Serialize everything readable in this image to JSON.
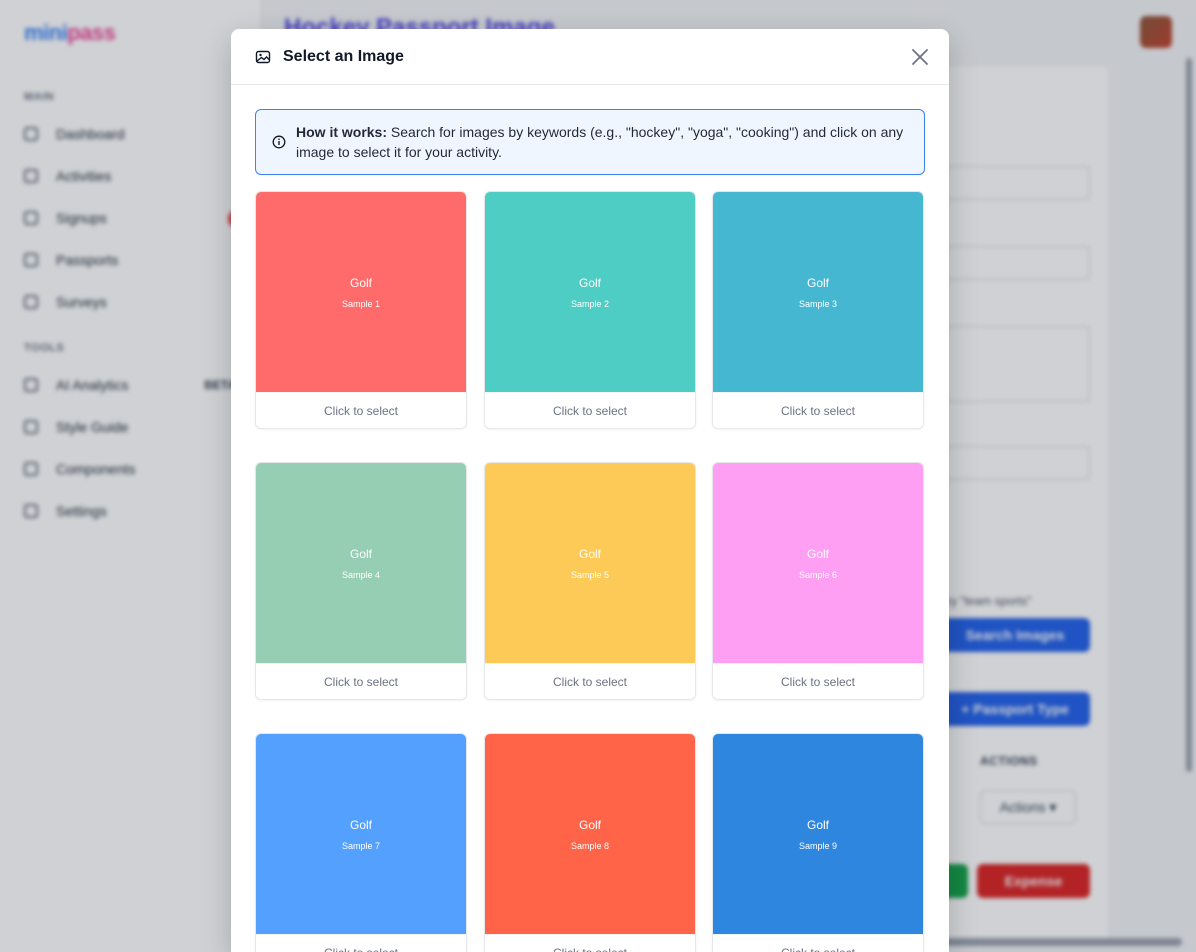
{
  "app": {
    "logo_part1": "mini",
    "logo_part2": "pass",
    "page_title": "Hockey Passport Image"
  },
  "sidebar": {
    "section_main": "MAIN",
    "section_tools": "TOOLS",
    "items": [
      {
        "label": "Dashboard",
        "icon": "home-icon"
      },
      {
        "label": "Activities",
        "icon": "activity-icon"
      },
      {
        "label": "Signups",
        "icon": "clipboard-icon"
      },
      {
        "label": "Passports",
        "icon": "passport-icon"
      },
      {
        "label": "Surveys",
        "icon": "survey-icon"
      }
    ],
    "tools": [
      {
        "label": "AI Analytics",
        "tag": "BETA",
        "icon": "analytics-icon"
      },
      {
        "label": "Style Guide",
        "icon": "palette-icon"
      },
      {
        "label": "Components",
        "icon": "components-icon"
      },
      {
        "label": "Settings",
        "icon": "settings-icon"
      }
    ]
  },
  "background": {
    "hint": "Try \"team sports\"",
    "search_images_button": "Search Images",
    "passport_type_button": "+ Passport Type",
    "actions_header": "ACTIONS",
    "actions_button": "Actions ▾",
    "expense_button": "Expense"
  },
  "modal": {
    "title": "Select an Image",
    "close_label": "×",
    "info_label": "How it works:",
    "info_text": "Search for images by keywords (e.g., \"hockey\", \"yoga\", \"cooking\") and click on any image to select it for your activity.",
    "tiles": [
      {
        "title": "Golf",
        "subtitle": "Sample 1",
        "footer": "Click to select",
        "color": "#ff6b6b"
      },
      {
        "title": "Golf",
        "subtitle": "Sample 2",
        "footer": "Click to select",
        "color": "#4ecdc4"
      },
      {
        "title": "Golf",
        "subtitle": "Sample 3",
        "footer": "Click to select",
        "color": "#45b7d1"
      },
      {
        "title": "Golf",
        "subtitle": "Sample 4",
        "footer": "Click to select",
        "color": "#96ceb4"
      },
      {
        "title": "Golf",
        "subtitle": "Sample 5",
        "footer": "Click to select",
        "color": "#feca57"
      },
      {
        "title": "Golf",
        "subtitle": "Sample 6",
        "footer": "Click to select",
        "color": "#ff9ff3"
      },
      {
        "title": "Golf",
        "subtitle": "Sample 7",
        "footer": "Click to select",
        "color": "#54a0ff"
      },
      {
        "title": "Golf",
        "subtitle": "Sample 8",
        "footer": "Click to select",
        "color": "#ff6348"
      },
      {
        "title": "Golf",
        "subtitle": "Sample 9",
        "footer": "Click to select",
        "color": "#2e86de"
      }
    ]
  }
}
